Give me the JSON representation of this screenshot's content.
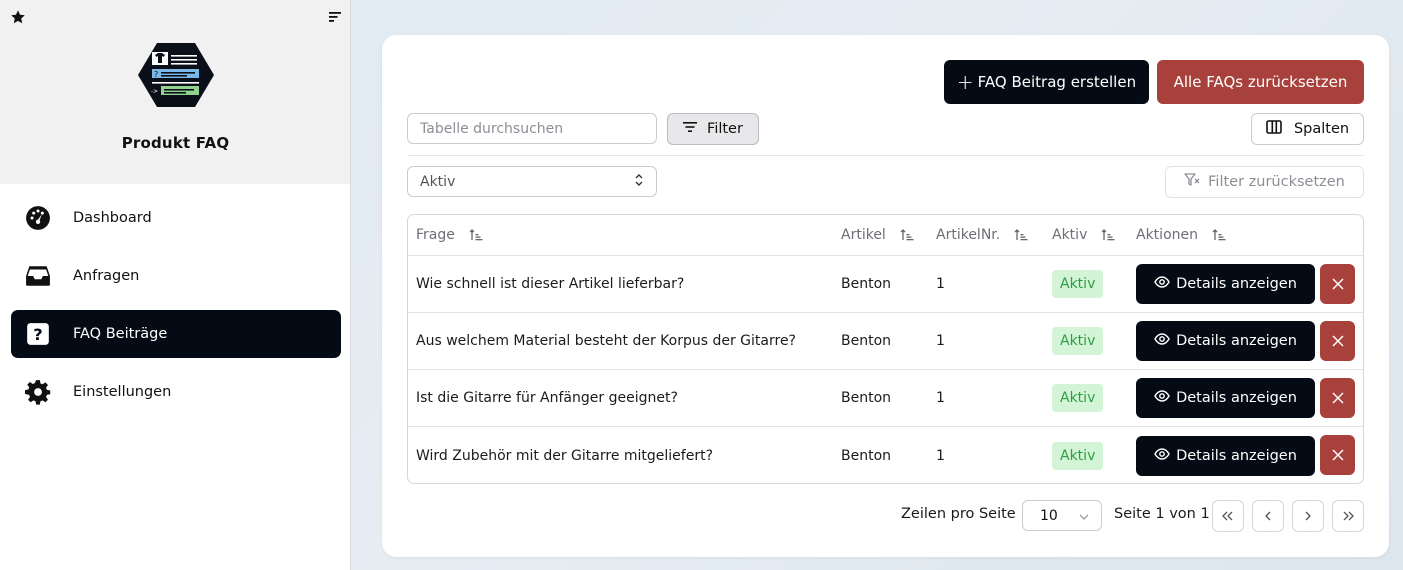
{
  "app": {
    "title": "Produkt FAQ"
  },
  "sidebar": {
    "items": [
      {
        "label": "Dashboard",
        "icon": "gauge-icon",
        "active": false
      },
      {
        "label": "Anfragen",
        "icon": "inbox-icon",
        "active": false
      },
      {
        "label": "FAQ Beiträge",
        "icon": "question-square-icon",
        "active": true
      },
      {
        "label": "Einstellungen",
        "icon": "gear-icon",
        "active": false
      }
    ]
  },
  "toolbar": {
    "create_label": "FAQ Beitrag erstellen",
    "create_plus": "+",
    "reset_all_label": "Alle FAQs zurücksetzen",
    "search_placeholder": "Tabelle durchsuchen",
    "filter_label": "Filter",
    "columns_label": "Spalten",
    "status_select_value": "Aktiv",
    "filter_reset_label": "Filter zurücksetzen"
  },
  "table": {
    "columns": [
      "Frage",
      "Artikel",
      "ArtikelNr.",
      "Aktiv",
      "Aktionen"
    ],
    "details_label": "Details anzeigen",
    "delete_label": "X",
    "rows": [
      {
        "frage": "Wie schnell ist dieser Artikel lieferbar?",
        "artikel": "Benton",
        "artikelnr": "1",
        "aktiv": "Aktiv"
      },
      {
        "frage": "Aus welchem Material besteht der Korpus der Gitarre?",
        "artikel": "Benton",
        "artikelnr": "1",
        "aktiv": "Aktiv"
      },
      {
        "frage": "Ist die Gitarre für Anfänger geeignet?",
        "artikel": "Benton",
        "artikelnr": "1",
        "aktiv": "Aktiv"
      },
      {
        "frage": "Wird Zubehör mit der Gitarre mitgeliefert?",
        "artikel": "Benton",
        "artikelnr": "1",
        "aktiv": "Aktiv"
      }
    ]
  },
  "pagination": {
    "rows_per_page_label": "Zeilen pro Seite",
    "rows_per_page_value": "10",
    "page_info": "Seite 1 von 1"
  },
  "colors": {
    "primary": "#050b14",
    "danger": "#a8403b",
    "success_bg": "#d3f4d6",
    "success_text": "#2f9e43"
  }
}
